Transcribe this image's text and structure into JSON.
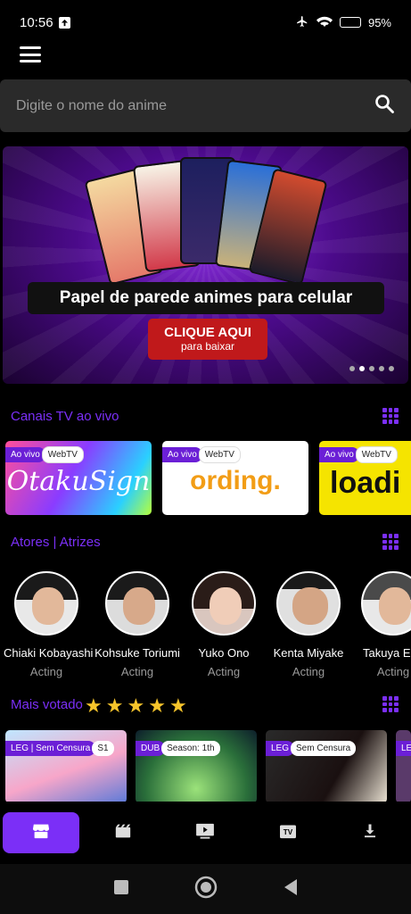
{
  "status": {
    "time": "10:56",
    "battery": "95%"
  },
  "search": {
    "placeholder": "Digite o nome do anime"
  },
  "banner": {
    "title": "Papel de parede animes para celular",
    "cta_line1": "CLIQUE AQUI",
    "cta_line2": "para baixar",
    "slides": 5,
    "active_slide": 2
  },
  "sections": {
    "channels": "Canais TV ao vivo",
    "actors": "Atores | Atrizes",
    "top": "Mais votado"
  },
  "channels": [
    {
      "live": "Ao vivo",
      "tag": "WebTV",
      "logo": "OtakuSign",
      "bg": "#8a3cff",
      "color": "#ffffff"
    },
    {
      "live": "Ao vivo",
      "tag": "WebTV",
      "logo": "ording.",
      "bg": "#ffffff",
      "color": "#f29d16"
    },
    {
      "live": "Ao vivo",
      "tag": "WebTV",
      "logo": "loadi",
      "bg": "#f5e400",
      "color": "#111111"
    }
  ],
  "actors": [
    {
      "name": "Chiaki Kobayashi",
      "role": "Acting"
    },
    {
      "name": "Kohsuke Toriumi",
      "role": "Acting"
    },
    {
      "name": "Yuko Ono",
      "role": "Acting"
    },
    {
      "name": "Kenta Miyake",
      "role": "Acting"
    },
    {
      "name": "Takuya Egu",
      "role": "Acting"
    }
  ],
  "rating_stars": 5,
  "top_anime": [
    {
      "tag1": "LEG | Sem Censura",
      "tag2": "S1"
    },
    {
      "tag1": "DUB",
      "tag2": "Season: 1th"
    },
    {
      "tag1": "LEG",
      "tag2": "Sem Censura"
    },
    {
      "tag1": "LE",
      "tag2": ""
    }
  ],
  "colors": {
    "accent": "#7b2ff7",
    "star": "#f6c52b"
  },
  "nav_icons": [
    "store-icon",
    "movie-icon",
    "play-icon",
    "tv-icon",
    "download-icon"
  ]
}
